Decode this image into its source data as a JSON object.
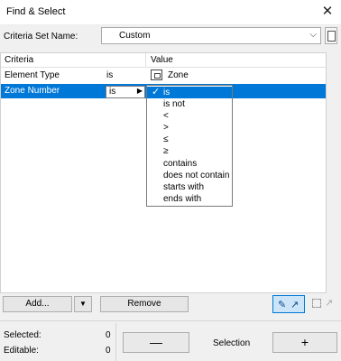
{
  "window": {
    "title": "Find & Select",
    "close_glyph": "✕"
  },
  "criteria_set": {
    "label": "Criteria Set Name:",
    "value": "Custom",
    "arrow": "⌵"
  },
  "table": {
    "columns": [
      "Criteria",
      "Value"
    ],
    "rows": [
      {
        "criteria": "Element Type",
        "operator": "is",
        "value": "Zone",
        "icon": "zone-icon"
      },
      {
        "criteria": "Zone Number",
        "operator": "is"
      }
    ]
  },
  "operator_dropdown": {
    "selected": "is",
    "options": [
      "is",
      "is not",
      "<",
      ">",
      "≤",
      "≥",
      "contains",
      "does not contain",
      "starts with",
      "ends with"
    ]
  },
  "buttons": {
    "add": "Add...",
    "add_drop": "▼",
    "remove": "Remove",
    "minus": "—",
    "plus": "+"
  },
  "stats": {
    "selected_label": "Selected:",
    "selected_value": "0",
    "editable_label": "Editable:",
    "editable_value": "0"
  },
  "selection_label": "Selection",
  "colors": {
    "highlight": "#0078d7"
  }
}
